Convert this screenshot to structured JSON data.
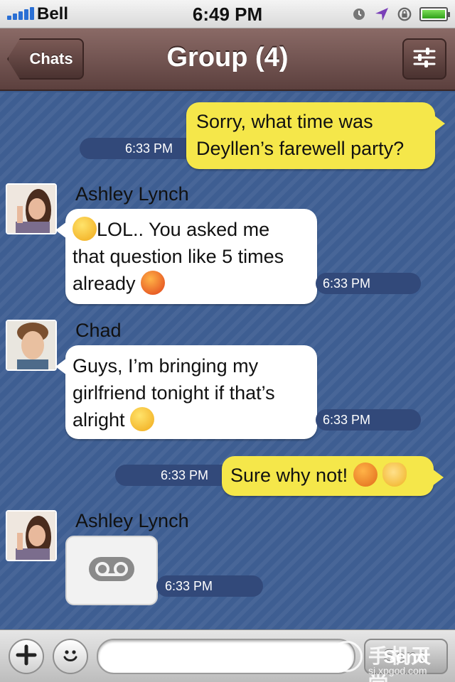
{
  "status_bar": {
    "carrier": "Bell",
    "time": "6:49 PM"
  },
  "nav": {
    "back_label": "Chats",
    "title": "Group (4)"
  },
  "messages": [
    {
      "from": "me",
      "lines": [
        "Sorry, what time was",
        "Deyllen’s farewell party?"
      ],
      "time": "6:33 PM"
    },
    {
      "sender": "Ashley Lynch",
      "lines": [
        "LOL.. You asked me",
        "that question like 5 times",
        "already"
      ],
      "emojis": [
        "scream-emoji",
        "devil-emoji"
      ],
      "time": "6:33 PM"
    },
    {
      "sender": "Chad",
      "lines": [
        "Guys, I’m bringing my",
        "girlfriend tonight if that’s",
        "alright"
      ],
      "emojis": [
        "wink-tongue-emoji"
      ],
      "time": "6:33 PM"
    },
    {
      "from": "me",
      "text": "Sure why not!",
      "emojis": [
        "imp-emoji",
        "ok-hand-emoji"
      ],
      "time": "6:33 PM"
    },
    {
      "sender": "Ashley Lynch",
      "attachment": "voice-message-icon",
      "time": "6:33 PM"
    }
  ],
  "input": {
    "placeholder": "",
    "send_label": "Send"
  },
  "watermark": {
    "title": "手机天堂",
    "url": "sj.xpgod.com"
  },
  "colors": {
    "nav": "#6b4d4a",
    "chat_bg": "#3e5e92",
    "my_bubble": "#f5e74a",
    "their_bubble": "#ffffff",
    "timestamp_pill": "#32497a"
  }
}
